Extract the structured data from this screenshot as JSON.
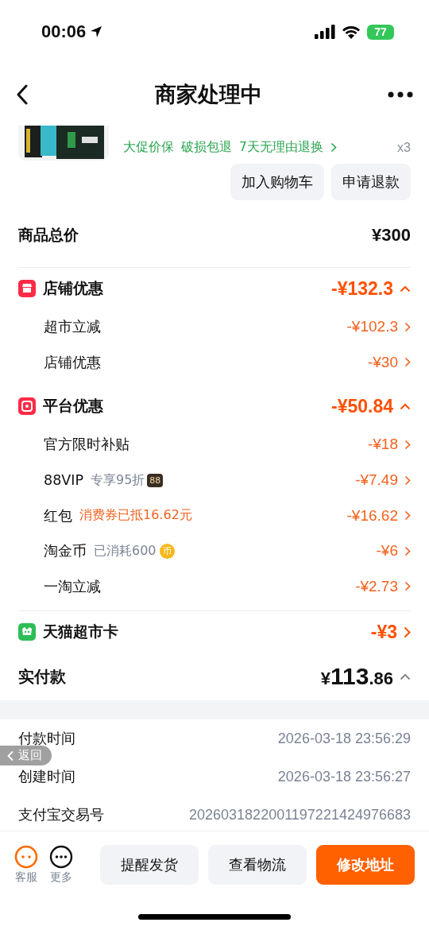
{
  "status_bar": {
    "time": "00:06",
    "battery": "77"
  },
  "nav": {
    "title": "商家处理中"
  },
  "product": {
    "tags": [
      "大促价保",
      "破损包退",
      "7天无理由退换"
    ],
    "quantity": "x3",
    "buttons": [
      "加入购物车",
      "申请退款"
    ]
  },
  "total": {
    "label": "商品总价",
    "value": "¥300"
  },
  "discount_groups": [
    {
      "kind": "store",
      "label": "店铺优惠",
      "amount": "-¥132.3",
      "expanded": true,
      "items": [
        {
          "label": "超市立减",
          "amount": "-¥102.3"
        },
        {
          "label": "店铺优惠",
          "amount": "-¥30"
        }
      ]
    },
    {
      "kind": "platform",
      "label": "平台优惠",
      "amount": "-¥50.84",
      "expanded": true,
      "items": [
        {
          "label": "官方限时补贴",
          "amount": "-¥18"
        },
        {
          "label": "88VIP",
          "note": "专享95折",
          "highlighted": false,
          "badge": {
            "kind": "vip",
            "text": "88"
          },
          "amount": "-¥7.49"
        },
        {
          "label": "红包",
          "note": "消费券已抵16.62元",
          "highlighted": true,
          "amount": "-¥16.62"
        },
        {
          "label": "淘金币",
          "note": "已消耗600",
          "highlighted": false,
          "badge": {
            "kind": "coin",
            "text": "币"
          },
          "amount": "-¥6"
        },
        {
          "label": "一淘立减",
          "amount": "-¥2.73"
        }
      ]
    }
  ],
  "card": {
    "label": "天猫超市卡",
    "amount": "-¥3"
  },
  "paid": {
    "label": "实付款",
    "currency": "¥",
    "integer": "113",
    "decimal": ".86",
    "expanded": true
  },
  "info_rows": [
    {
      "label": "付款时间",
      "value": "2026-03-18 23:56:29"
    },
    {
      "label": "创建时间",
      "value": "2026-03-18 23:56:27"
    },
    {
      "label": "支付宝交易号",
      "value": "2026031822001197221424976683"
    }
  ],
  "back_overlay": {
    "label": "返回"
  },
  "bottom_bar": {
    "tools": [
      {
        "kind": "service",
        "label": "客服"
      },
      {
        "kind": "more",
        "label": "更多"
      }
    ],
    "buttons": [
      {
        "label": "提醒发货",
        "primary": false
      },
      {
        "label": "查看物流",
        "primary": false
      },
      {
        "label": "修改地址",
        "primary": true
      }
    ]
  }
}
